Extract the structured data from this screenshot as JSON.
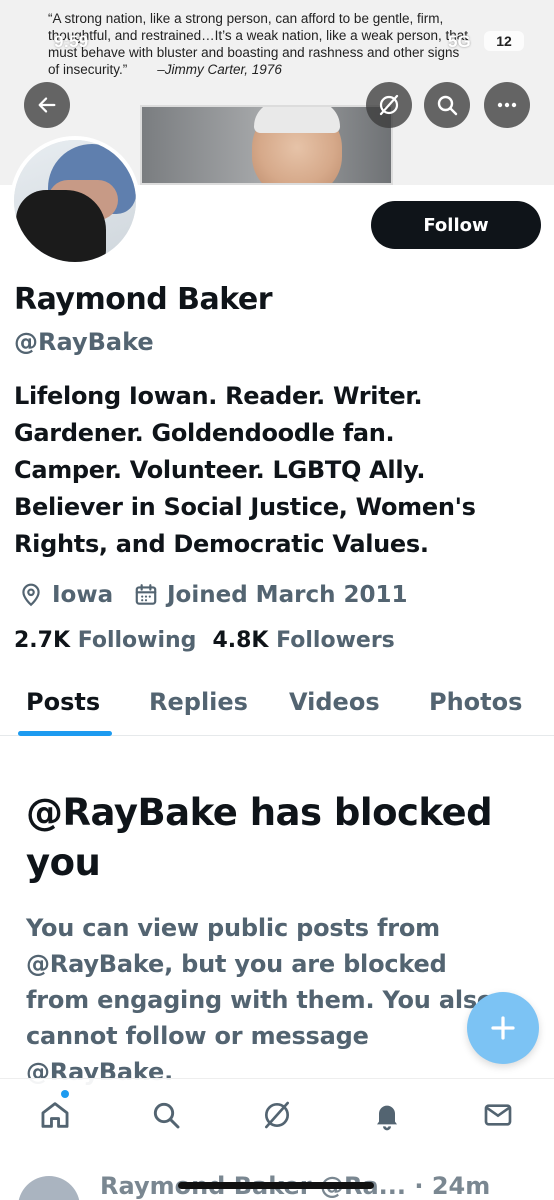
{
  "status_bar": {
    "time": "9:59",
    "network": "5G",
    "battery": "12"
  },
  "banner": {
    "quote_lines": [
      "“A strong nation, like a strong person, can afford to be gentle, firm,",
      "thoughtful, and restrained…It’s a weak nation, like a weak person, that",
      "must behave with bluster and boasting and rashness and other signs",
      "of insecurity.”"
    ],
    "attribution": "–Jimmy Carter, 1976"
  },
  "toolbar": {
    "back_icon": "arrow-left-icon",
    "grok_icon": "slash-circle-icon",
    "search_icon": "search-icon",
    "more_icon": "more-icon"
  },
  "profile": {
    "name": "Raymond Baker",
    "handle": "@RayBake",
    "follow_label": "Follow",
    "bio_lines": [
      "Lifelong Iowan. Reader. Writer.",
      "Gardener. Goldendoodle fan.",
      "Camper. Volunteer. LGBTQ Ally.",
      "Believer in Social Justice, Women's",
      "Rights, and Democratic Values."
    ],
    "location": "Iowa",
    "joined": "Joined March 2011",
    "following_count": "2.7K",
    "following_label": "Following",
    "followers_count": "4.8K",
    "followers_label": "Followers"
  },
  "tabs": [
    {
      "label": "Posts",
      "active": true
    },
    {
      "label": "Replies",
      "active": false
    },
    {
      "label": "Videos",
      "active": false
    },
    {
      "label": "Photos",
      "active": false
    }
  ],
  "blocked": {
    "title_line1": "@RayBake has blocked",
    "title_line2": "you",
    "message_lines": [
      "You can view public posts from",
      "@RayBake, but you are blocked",
      "from engaging with them. You also",
      "cannot follow or message",
      "@RayBake."
    ]
  },
  "fab": {
    "icon": "plus-icon"
  },
  "bottom_nav": [
    {
      "icon": "home-icon"
    },
    {
      "icon": "search-icon"
    },
    {
      "icon": "slash-circle-icon"
    },
    {
      "icon": "bell-icon"
    },
    {
      "icon": "mail-icon"
    }
  ],
  "peek_post": {
    "text": "Raymond Baker @Ra... · 24m"
  },
  "colors": {
    "accent": "#1d9bf0",
    "text": "#0f1419",
    "muted": "#536471",
    "fab": "#7cc3f4"
  }
}
